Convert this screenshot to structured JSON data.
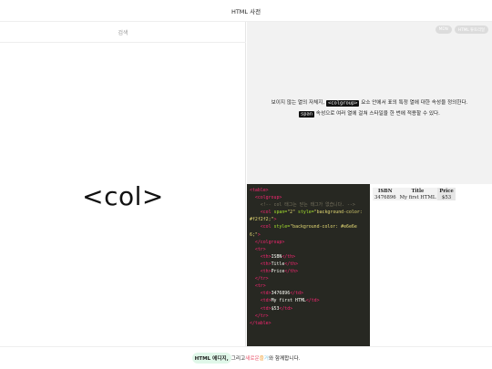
{
  "header": {
    "title": "HTML 사전"
  },
  "search": {
    "placeholder": "검색"
  },
  "main": {
    "term": "<col>"
  },
  "badges": [
    {
      "label": "MDN"
    },
    {
      "label": "HTML 튜토리얼"
    }
  ],
  "description": {
    "line1_before": "보이지 않는 열의 자체지,",
    "line1_tag": "<colgroup>",
    "line1_after": "요소 안에서 표의 특정 열에 대한 속성을 정의한다.",
    "line2_tag": "span",
    "line2_after": "속성으로 여러 열에 걸쳐 스타일을 한 번에 적용할 수 있다."
  },
  "code": {
    "l1": "<table>",
    "l2": "<colgroup>",
    "l3": "<!-- col 태그는 닫는 태그가 없습니다. -->",
    "l4_tag": "<col",
    "l4_attr1": " span=",
    "l4_v1": "\"2\"",
    "l4_attr2": " style=",
    "l4_v2": "\"background-color: #f2f2f2;\"",
    "l4_end": ">",
    "l5_tag": "<col",
    "l5_attr": " style=",
    "l5_v": "\"background-color: #e6e6e6;\"",
    "l5_end": ">",
    "l6": "</colgroup>",
    "l7": "<tr>",
    "l8_open": "<th>",
    "l8_text": "ISBN",
    "l8_close": "</th>",
    "l9_open": "<th>",
    "l9_text": "Title",
    "l9_close": "</th>",
    "l10_open": "<th>",
    "l10_text": "Price",
    "l10_close": "</th>",
    "l11": "</tr>",
    "l12": "<tr>",
    "l13_open": "<td>",
    "l13_text": "3476896",
    "l13_close": "</td>",
    "l14_open": "<td>",
    "l14_text": "My first HTML",
    "l14_close": "</td>",
    "l15_open": "<td>",
    "l15_text": "$53",
    "l15_close": "</td>",
    "l16": "</tr>",
    "l17": "</table>"
  },
  "preview": {
    "headers": [
      "ISBN",
      "Title",
      "Price"
    ],
    "row": [
      "3476896",
      "My first HTML",
      "$53"
    ]
  },
  "footer": {
    "highlight": "HTML 에디지,",
    "middle": " 그리고 ",
    "new_word": "새로운",
    "joy_a": " 즐",
    "joy_b": "거",
    "end": "와 함께합니다."
  },
  "colors": {
    "code_bg": "#272822",
    "tag": "#f92672",
    "attr": "#a6e22e",
    "string": "#e6db74"
  }
}
